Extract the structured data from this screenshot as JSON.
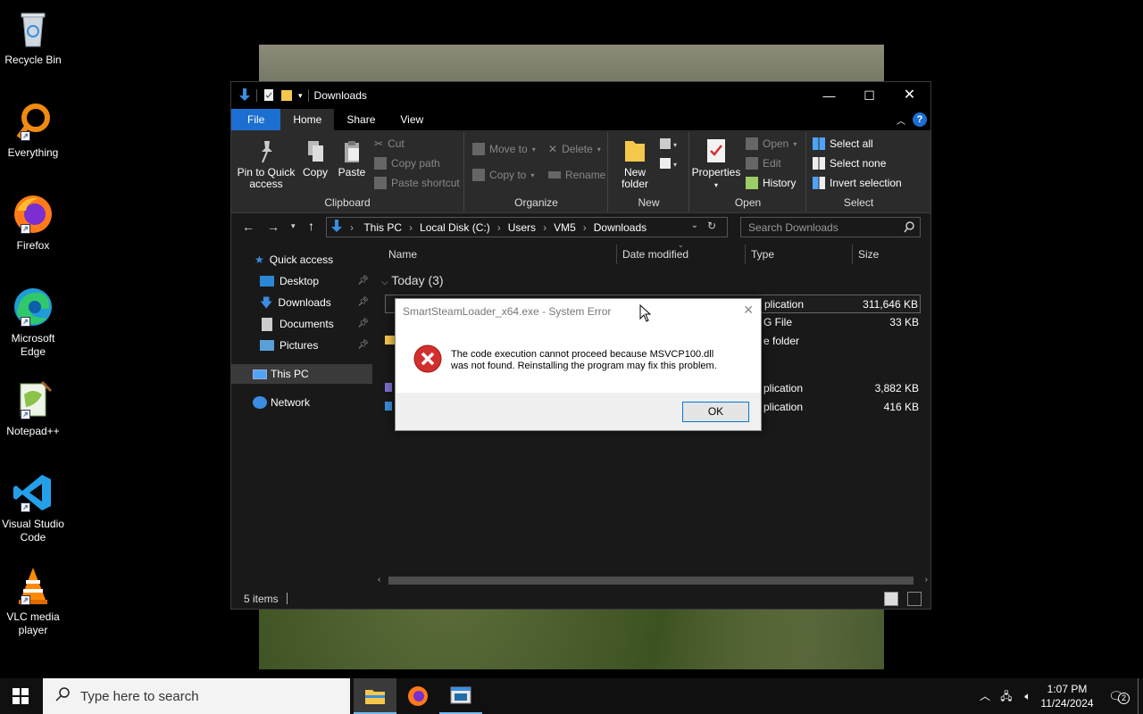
{
  "desktop": {
    "icons": [
      {
        "label": "Recycle Bin"
      },
      {
        "label": "Everything"
      },
      {
        "label": "Firefox"
      },
      {
        "label": "Microsoft Edge"
      },
      {
        "label": "Notepad++"
      },
      {
        "label": "Visual Studio Code"
      },
      {
        "label": "VLC media player"
      }
    ]
  },
  "explorer": {
    "title": "Downloads",
    "tabs": [
      "File",
      "Home",
      "Share",
      "View"
    ],
    "ribbon": {
      "clipboard": {
        "pin": "Pin to Quick access",
        "copy": "Copy",
        "paste": "Paste",
        "cut": "Cut",
        "copy_path": "Copy path",
        "paste_shortcut": "Paste shortcut",
        "label": "Clipboard"
      },
      "organize": {
        "move_to": "Move to",
        "copy_to": "Copy to",
        "delete": "Delete",
        "rename": "Rename",
        "label": "Organize"
      },
      "new": {
        "new_folder": "New folder",
        "label": "New"
      },
      "open": {
        "properties": "Properties",
        "open": "Open",
        "edit": "Edit",
        "history": "History",
        "label": "Open"
      },
      "select": {
        "select_all": "Select all",
        "select_none": "Select none",
        "invert": "Invert selection",
        "label": "Select"
      }
    },
    "breadcrumb": [
      "This PC",
      "Local Disk (C:)",
      "Users",
      "VM5",
      "Downloads"
    ],
    "search_placeholder": "Search Downloads",
    "nav": {
      "quick_access": "Quick access",
      "desktop": "Desktop",
      "downloads": "Downloads",
      "documents": "Documents",
      "pictures": "Pictures",
      "this_pc": "This PC",
      "network": "Network"
    },
    "columns": {
      "name": "Name",
      "date": "Date modified",
      "type": "Type",
      "size": "Size"
    },
    "group_today": "Today (3)",
    "rows": [
      {
        "type": "plication",
        "size": "311,646 KB"
      },
      {
        "type": "G File",
        "size": "33 KB"
      },
      {
        "type": "e folder",
        "size": ""
      },
      {
        "type": "plication",
        "size": "3,882 KB"
      },
      {
        "type": "plication",
        "size": "416 KB"
      }
    ],
    "status": "5 items"
  },
  "dialog": {
    "title": "SmartSteamLoader_x64.exe - System Error",
    "message_line1": "The code execution cannot proceed because MSVCP100.dll",
    "message_line2": "was not found. Reinstalling the program may fix this problem.",
    "ok": "OK"
  },
  "taskbar": {
    "search_placeholder": "Type here to search",
    "time": "1:07 PM",
    "date": "11/24/2024",
    "notification_count": "2"
  },
  "colors": {
    "accent": "#1c6fd1",
    "error": "#d32f2f",
    "ok_border": "#0078d7"
  }
}
